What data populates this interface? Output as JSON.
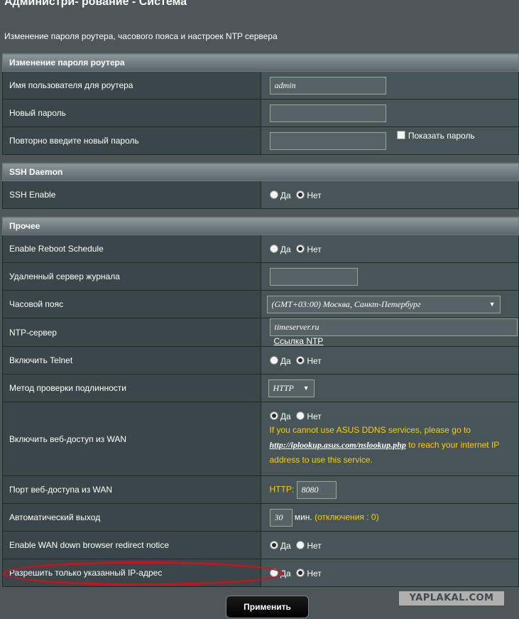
{
  "page": {
    "title": "Администри- рование - Система",
    "subtitle": "Изменение пароля роутера, часового пояса и настроек NTP сервера"
  },
  "sections": {
    "password": {
      "header": "Изменение пароля роутера",
      "username_label": "Имя пользователя для роутера",
      "username_value": "admin",
      "new_password_label": "Новый пароль",
      "new_password_value": "",
      "repeat_password_label": "Повторно введите новый пароль",
      "repeat_password_value": "",
      "show_password_label": "Показать пароль",
      "show_password_checked": false
    },
    "ssh": {
      "header": "SSH Daemon",
      "enable_label": "SSH Enable",
      "enable_value": "Нет"
    },
    "misc": {
      "header": "Прочее",
      "reboot_label": "Enable Reboot Schedule",
      "reboot_value": "Нет",
      "log_server_label": "Удаленный сервер журнала",
      "log_server_value": "",
      "timezone_label": "Часовой пояс",
      "timezone_value": "(GMT+03:00) Москва, Санкт-Петербург",
      "ntp_label": "NTP-сервер",
      "ntp_value": "timeserver.ru",
      "ntp_link": "Ссылка NTP",
      "telnet_label": "Включить Telnet",
      "telnet_value": "Нет",
      "auth_label": "Метод проверки подлинности",
      "auth_value": "HTTP",
      "wan_access_label": "Включить веб-доступ из WAN",
      "wan_access_value": "Да",
      "wan_warning_pre": "If you cannot use ASUS DDNS services, please go to",
      "wan_warning_url": "http://iplookup.asus.com/nslookup.php",
      "wan_warning_post": "to reach your internet IP address to use this service.",
      "wan_port_label": "Порт веб-доступа из WAN",
      "wan_port_prefix": "HTTP:",
      "wan_port_value": "8080",
      "autologout_label": "Автоматический выход",
      "autologout_value": "30",
      "autologout_unit": "мин.",
      "autologout_hint": "(отключения : 0)",
      "wan_redirect_label": "Enable WAN down browser redirect notice",
      "wan_redirect_value": "Да",
      "ip_restrict_label": "Разрешить только указанный IP-адрес",
      "ip_restrict_value": "Нет"
    }
  },
  "radio_labels": {
    "yes": "Да",
    "no": "Нет"
  },
  "apply_button": "Применить",
  "watermark": "YAPLAKAL.COM",
  "colors": {
    "page_bg": "#4d5659",
    "label_cell_bg": "#3a4649",
    "value_cell_bg": "#475558",
    "warning_text": "#ffcc00",
    "annotation_circle": "#d0101a"
  }
}
